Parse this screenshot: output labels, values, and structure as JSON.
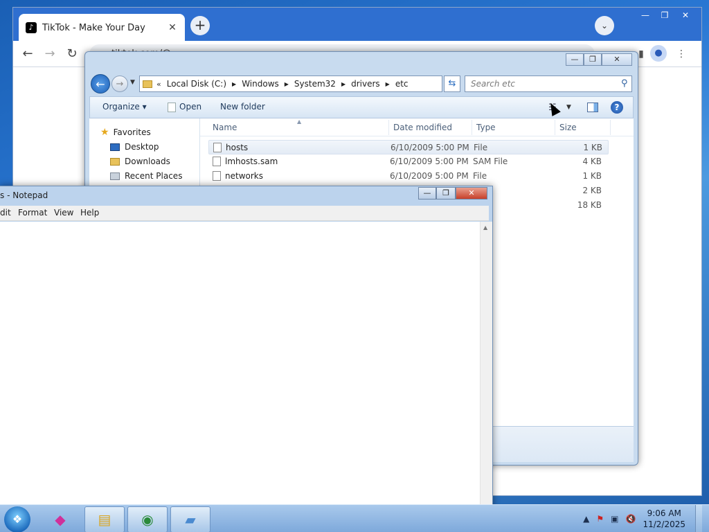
{
  "chrome": {
    "tab_title": "TikTok - Make Your Day",
    "tab_close": "✕",
    "new_tab": "+",
    "tab_search": "⌄",
    "url": "tiktok.com/@...",
    "back": "←",
    "forward": "→",
    "reload": "↻",
    "win_min": "—",
    "win_max": "❐",
    "win_close": "✕",
    "menu": "⋮"
  },
  "explorer": {
    "breadcrumb": [
      "Local Disk (C:)",
      "Windows",
      "System32",
      "drivers",
      "etc"
    ],
    "breadcrumb_prefix": "«",
    "search_placeholder": "Search etc",
    "toolbar": {
      "organize": "Organize ▾",
      "open": "Open",
      "new_folder": "New folder"
    },
    "nav": {
      "favorites": "Favorites",
      "items": [
        "Desktop",
        "Downloads",
        "Recent Places"
      ]
    },
    "columns": [
      "Name",
      "Date modified",
      "Type",
      "Size"
    ],
    "files": [
      {
        "name": "hosts",
        "date": "6/10/2009 5:00 PM",
        "type": "File",
        "size": "1 KB"
      },
      {
        "name": "lmhosts.sam",
        "date": "6/10/2009 5:00 PM",
        "type": "SAM File",
        "size": "4 KB"
      },
      {
        "name": "networks",
        "date": "6/10/2009 5:00 PM",
        "type": "File",
        "size": "1 KB"
      }
    ],
    "hidden_sizes": [
      "2 KB",
      "18 KB"
    ]
  },
  "notepad": {
    "title": "s - Notepad",
    "menu": [
      "dit",
      "Format",
      "View",
      "Help"
    ],
    "content": ""
  },
  "taskbar": {
    "time": "9:06 AM",
    "date": "11/2/2025",
    "tray_arrow": "▲"
  },
  "colors": {
    "chrome_tabstrip": "#2f6fd0",
    "explorer_frame": "#c8dbef",
    "taskbar": "#8fb4e2"
  }
}
